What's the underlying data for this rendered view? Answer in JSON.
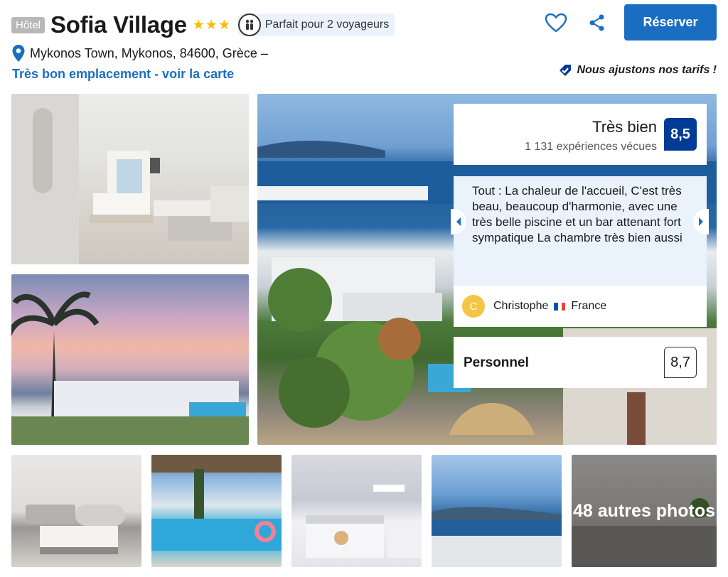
{
  "header": {
    "type_badge": "Hôtel",
    "hotel_name": "Sofia Village",
    "stars": "★★★",
    "traveler_badge": "Parfait pour 2 voyageurs",
    "reserve_label": "Réserver",
    "address": "Mykonos Town, Mykonos, 84600, Grèce –",
    "location_link": "Très bon emplacement - voir la carte",
    "price_note": "Nous ajustons nos tarifs !"
  },
  "review_overlay": {
    "score_label": "Très bien",
    "score_value": "8,5",
    "review_count": "1 131 expériences vécues",
    "review_text": "Tout : La chaleur de l'accueil, C'est très beau, beaucoup d'harmonie, avec une très belle piscine et un bar attenant fort sympatique La chambre très bien aussi",
    "reviewer_initial": "C",
    "reviewer_name": "Christophe",
    "reviewer_country": "France",
    "category_label": "Personnel",
    "category_score": "8,7"
  },
  "gallery": {
    "more_photos_label": "48 autres photos"
  },
  "colors": {
    "accent": "#1a6ec2",
    "score_bg": "#003b95",
    "stars": "#febb02",
    "review_bg": "#eaf2fc"
  },
  "icons": {
    "heart": "heart-icon",
    "share": "share-icon",
    "pin": "map-pin-icon",
    "tag": "price-tag-icon",
    "travelers": "two-people-icon"
  }
}
